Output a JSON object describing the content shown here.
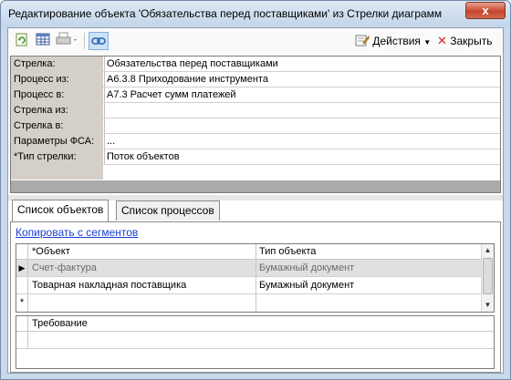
{
  "window": {
    "title": "Редактирование объекта 'Обязательства перед поставщиками' из Стрелки диаграмм",
    "close_glyph": "x"
  },
  "toolbar": {
    "actions_label": "Действия",
    "close_label": "Закрыть",
    "icons": [
      "refresh-icon",
      "table-icon",
      "print-icon",
      "link-icon",
      "actions-icon",
      "close-icon"
    ]
  },
  "properties": [
    {
      "label": "Стрелка:",
      "value": "Обязательства перед поставщиками"
    },
    {
      "label": "Процесс из:",
      "value": "А6.3.8 Приходование инструмента"
    },
    {
      "label": "Процесс в:",
      "value": "А7.3 Расчет сумм платежей"
    },
    {
      "label": "Стрелка из:",
      "value": ""
    },
    {
      "label": "Стрелка в:",
      "value": ""
    },
    {
      "label": "Параметры ФСА:",
      "value": "..."
    },
    {
      "label": "*Тип стрелки:",
      "value": "Поток объектов"
    }
  ],
  "tabs": [
    {
      "label": "Список объектов",
      "active": true
    },
    {
      "label": "Список процессов",
      "active": false
    }
  ],
  "objects_panel": {
    "copy_link": "Копировать с сегментов",
    "columns": [
      "*Объект",
      "Тип объекта"
    ],
    "rows": [
      {
        "indicator": "▶",
        "object": "Счет-фактура",
        "type": "Бумажный документ",
        "selected": true
      },
      {
        "indicator": "",
        "object": "Товарная накладная поставщика",
        "type": "Бумажный документ",
        "selected": false
      }
    ],
    "new_row_indicator": "*"
  },
  "requirements_grid": {
    "columns": [
      "Требование"
    ]
  },
  "colors": {
    "title_bar": "#c4d5ea",
    "link": "#1a3fd1",
    "label_bg": "#d4d0c8",
    "close_button": "#c8452c"
  }
}
